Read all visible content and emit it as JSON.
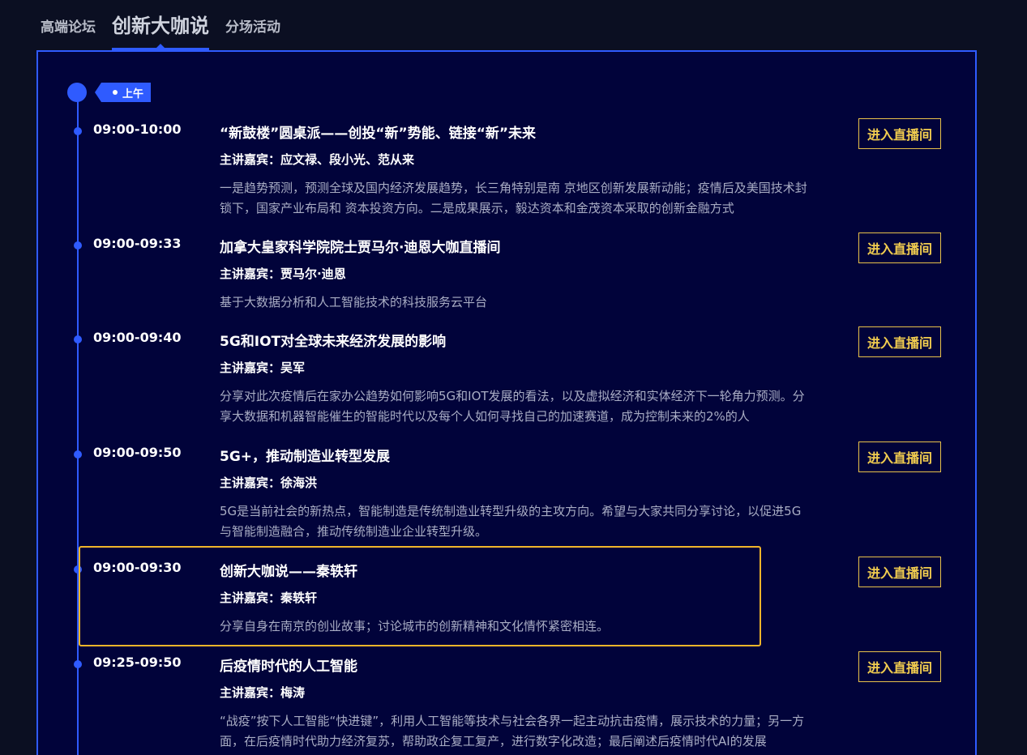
{
  "tabs": [
    {
      "label": "高端论坛",
      "active": false
    },
    {
      "label": "创新大咖说",
      "active": true
    },
    {
      "label": "分场活动",
      "active": false
    }
  ],
  "period_tag": "上午",
  "live_button_label": "进入直播间",
  "accent_color": "#2f5bff",
  "highlight_color": "#f0b52a",
  "button_color": "#f2cd4f",
  "items": [
    {
      "time": "09:00-10:00",
      "title": "“新鼓楼”圆桌派——创投“新”势能、链接“新”未来",
      "speaker": "主讲嘉宾：应文禄、段小光、范从来",
      "desc": "一是趋势预测，预测全球及国内经济发展趋势，长三角特别是南 京地区创新发展新动能；疫情后及美国技术封锁下，国家产业布局和 资本投资方向。二是成果展示，毅达资本和金茂资本采取的创新金融方式"
    },
    {
      "time": "09:00-09:33",
      "title": "加拿大皇家科学院院士贾马尔·迪恩大咖直播间",
      "speaker": "主讲嘉宾：贾马尔·迪恩",
      "desc": "基于大数据分析和人工智能技术的科技服务云平台"
    },
    {
      "time": "09:00-09:40",
      "title": "5G和IOT对全球未来经济发展的影响",
      "speaker": "主讲嘉宾：吴军",
      "desc": "分享对此次疫情后在家办公趋势如何影响5G和IOT发展的看法，以及虚拟经济和实体经济下一轮角力预测。分享大数据和机器智能催生的智能时代以及每个人如何寻找自己的加速赛道，成为控制未来的2%的人"
    },
    {
      "time": "09:00-09:50",
      "title": "5G+，推动制造业转型发展",
      "speaker": "主讲嘉宾：徐海洪",
      "desc": "5G是当前社会的新热点，智能制造是传统制造业转型升级的主攻方向。希望与大家共同分享讨论，以促进5G与智能制造融合，推动传统制造业企业转型升级。"
    },
    {
      "time": "09:00-09:30",
      "title": "创新大咖说——秦轶轩",
      "speaker": "主讲嘉宾：秦轶轩",
      "desc": "分享自身在南京的创业故事；讨论城市的创新精神和文化情怀紧密相连。"
    },
    {
      "time": "09:25-09:50",
      "title": "后疫情时代的人工智能",
      "speaker": "主讲嘉宾：梅涛",
      "desc": "“战疫”按下人工智能“快进键”，利用人工智能等技术与社会各界一起主动抗击疫情，展示技术的力量；另一方面，在后疫情时代助力经济复苏，帮助政企复工复产，进行数字化改造；最后阐述后疫情时代AI的发展"
    }
  ]
}
